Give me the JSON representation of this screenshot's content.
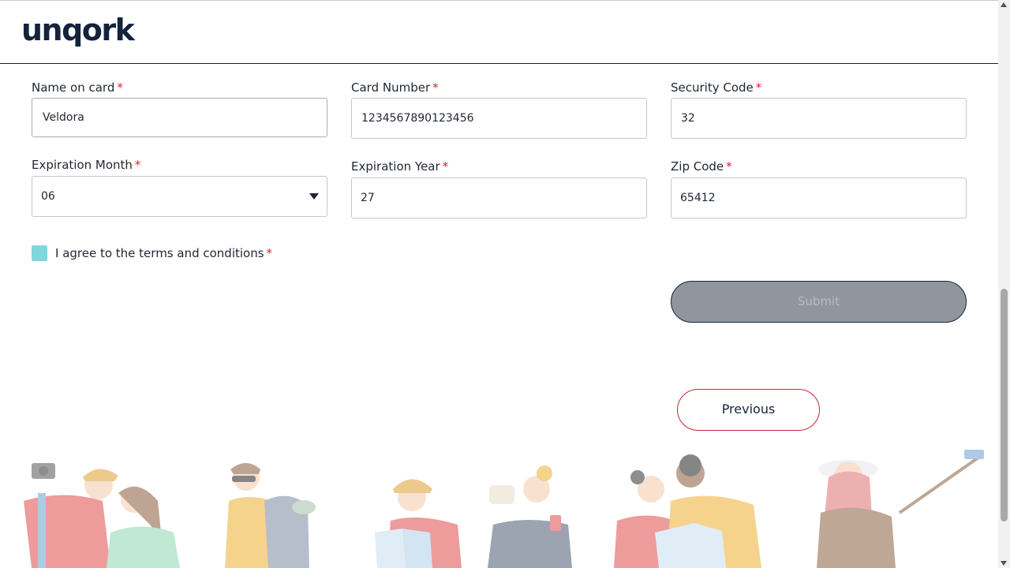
{
  "header": {
    "logo_text": "unqork"
  },
  "form": {
    "required_marker": "*",
    "name_on_card": {
      "label": "Name on card",
      "value": "Veldora"
    },
    "card_number": {
      "label": "Card Number",
      "value": "1234567890123456"
    },
    "security_code": {
      "label": "Security Code",
      "value": "32"
    },
    "expiration_month": {
      "label": "Expiration Month",
      "value": "06"
    },
    "expiration_year": {
      "label": "Expiration Year",
      "value": "27"
    },
    "zip_code": {
      "label": "Zip Code",
      "value": "65412"
    },
    "terms": {
      "label": "I agree to the terms and conditions",
      "checked": true
    },
    "submit_label": "Submit",
    "previous_label": "Previous"
  },
  "colors": {
    "brand": "#14233c",
    "required": "#e0202e",
    "checkbox": "#7fd6dc",
    "submit_bg": "#8f969e",
    "previous_border": "#c8243a"
  },
  "icons": [
    "select-arrow-icon",
    "scroll-up-icon",
    "scroll-down-icon"
  ]
}
